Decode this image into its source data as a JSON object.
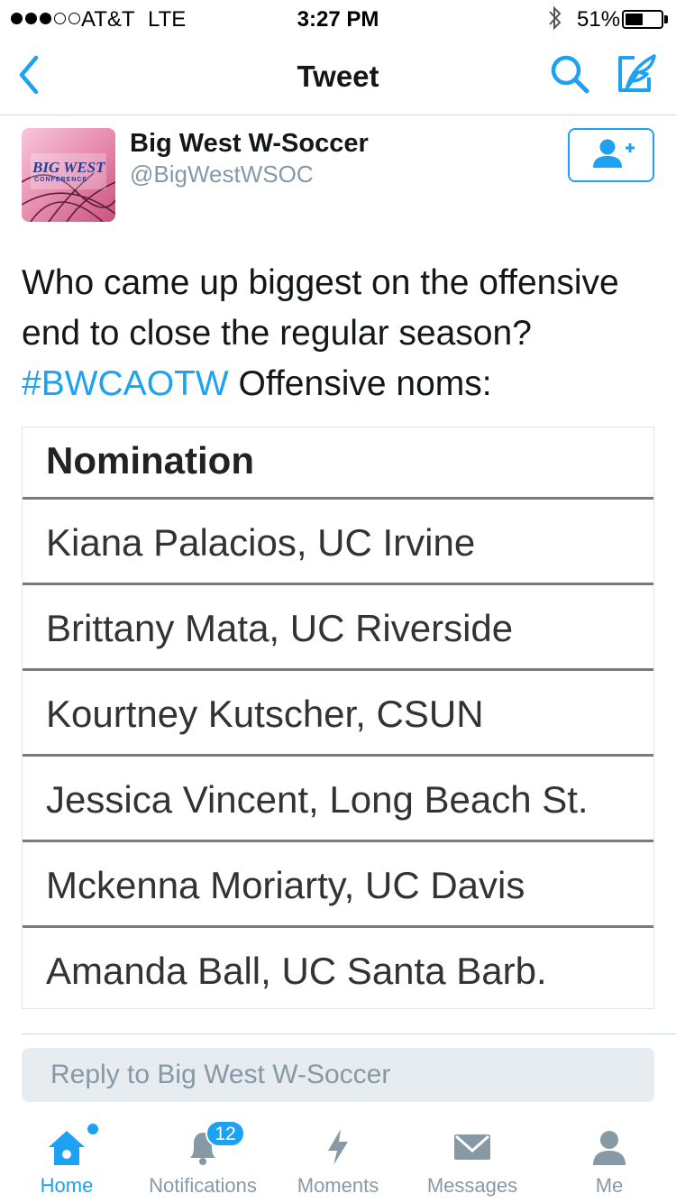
{
  "status_bar": {
    "carrier": "AT&T",
    "network": "LTE",
    "time": "3:27 PM",
    "battery_percent": "51%",
    "battery_level": 0.51,
    "signal_bars": 3,
    "signal_total": 5
  },
  "nav": {
    "title": "Tweet",
    "back_icon": "chevron-left-icon",
    "search_icon": "search-icon",
    "compose_icon": "compose-tweet-icon"
  },
  "author": {
    "display_name": "Big West W-Soccer",
    "handle": "@BigWestWSOC",
    "avatar_text": "BIG WEST",
    "avatar_subtext": "CONFERENCE",
    "follow_icon": "follow-user-icon"
  },
  "tweet": {
    "text_before": "Who came up biggest on the offensive end to close the regular season? ",
    "hashtag": "#BWCAOTW",
    "text_after": " Offensive noms:"
  },
  "media": {
    "header": "Nomination",
    "rows": [
      "Kiana Palacios, UC Irvine",
      "Brittany Mata, UC Riverside",
      "Kourtney Kutscher, CSUN",
      "Jessica Vincent, Long Beach St.",
      "Mckenna Moriarty, UC Davis",
      "Amanda Ball, UC Santa Barb."
    ]
  },
  "reply": {
    "placeholder": "Reply to Big West W-Soccer"
  },
  "tabbar": {
    "home": "Home",
    "notifications": "Notifications",
    "notifications_badge": "12",
    "moments": "Moments",
    "messages": "Messages",
    "me": "Me"
  },
  "colors": {
    "accent": "#1da1f2",
    "muted": "#8899a6",
    "text": "#14171a",
    "reply_bg": "#e6ecf0"
  }
}
